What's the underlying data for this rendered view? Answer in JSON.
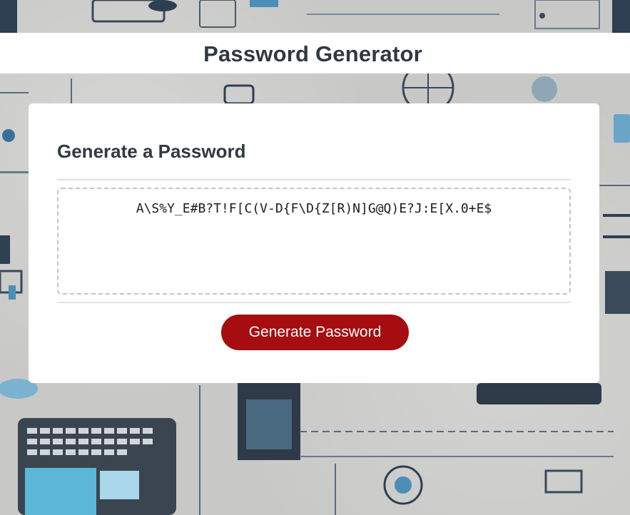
{
  "header": {
    "title": "Password Generator"
  },
  "card": {
    "heading": "Generate a Password",
    "password_value": "A\\S%Y_E#B?T!F[C(V-D{F\\D{Z[R)N]G@Q)E?J:E[X.0+E$",
    "generate_label": "Generate Password"
  },
  "colors": {
    "title_text": "#303941",
    "button_bg": "#a50d10",
    "button_text": "#ffffff",
    "card_bg": "#ffffff"
  }
}
